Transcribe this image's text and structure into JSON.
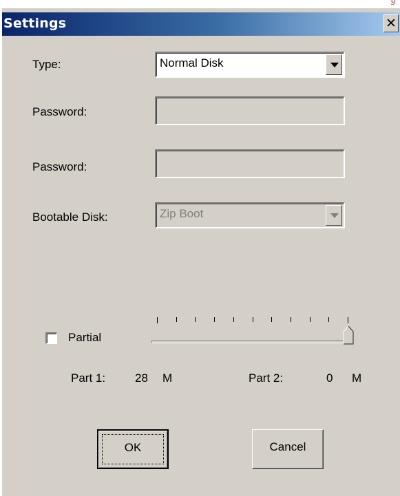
{
  "background": {
    "partial_text": "g"
  },
  "window": {
    "title": "Settings",
    "close_label": "✕"
  },
  "form": {
    "type_label": "Type:",
    "type_value": "Normal Disk",
    "password_label_1": "Password:",
    "password_value_1": "",
    "password_label_2": "Password:",
    "password_value_2": "",
    "bootable_label": "Bootable Disk:",
    "bootable_value": "Zip Boot"
  },
  "partition": {
    "checkbox_label": "Partial",
    "checked": false,
    "slider_level_fraction": 1.0,
    "tick_count": 11,
    "part1_label": "Part 1:",
    "part1_value": "28",
    "part1_unit": "M",
    "part2_label": "Part 2:",
    "part2_value": "0",
    "part2_unit": "M"
  },
  "buttons": {
    "ok_label": "OK",
    "cancel_label": "Cancel"
  },
  "colors": {
    "title_gradient_start": "#0a246a",
    "title_gradient_end": "#a6caf0",
    "face": "#d4d0c8",
    "disabled_text": "#808080"
  }
}
